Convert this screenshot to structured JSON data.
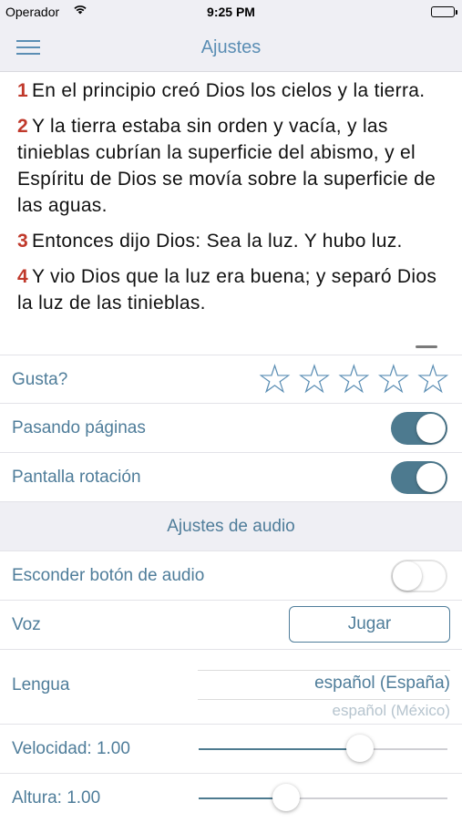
{
  "status_bar": {
    "carrier": "Operador",
    "time": "9:25 PM",
    "wifi_icon": "wifi-icon",
    "battery_icon": "battery-icon"
  },
  "nav": {
    "title": "Ajustes",
    "menu_icon": "hamburger-menu-icon"
  },
  "verses": [
    {
      "num": "1",
      "text": "En el principio creó Dios los cielos y la tierra."
    },
    {
      "num": "2",
      "text": "Y la tierra estaba sin orden y vacía, y las tinieblas cubrían la superficie del abismo, y el Espíritu de Dios se movía sobre la superficie de las aguas."
    },
    {
      "num": "3",
      "text": "Entonces dijo Dios: Sea la luz. Y hubo luz."
    },
    {
      "num": "4",
      "text": "Y vio Dios que la luz era buena; y separó Dios la luz de las tinieblas."
    }
  ],
  "settings": {
    "rating": {
      "label": "Gusta?",
      "stars_filled": 0,
      "stars_total": 5,
      "star_icon": "star-outline-icon"
    },
    "page_turning": {
      "label": "Pasando páginas",
      "enabled": true
    },
    "screen_rotation": {
      "label": "Pantalla rotación",
      "enabled": true
    },
    "audio_section_title": "Ajustes de audio",
    "hide_audio_button": {
      "label": "Esconder botón de audio",
      "enabled": false
    },
    "voice": {
      "label": "Voz",
      "button_label": "Jugar"
    },
    "language": {
      "label": "Lengua",
      "selected": "español (España)",
      "next_option": "español (México)"
    },
    "speed": {
      "label": "Velocidad: 1.00",
      "value": 0.65
    },
    "pitch": {
      "label": "Altura: 1.00",
      "value": 0.35
    }
  },
  "colors": {
    "accent": "#5b8eb4",
    "toggle_on": "#4d7a8f",
    "verse_number": "#c0392b",
    "grouped_background": "#efeff4"
  }
}
